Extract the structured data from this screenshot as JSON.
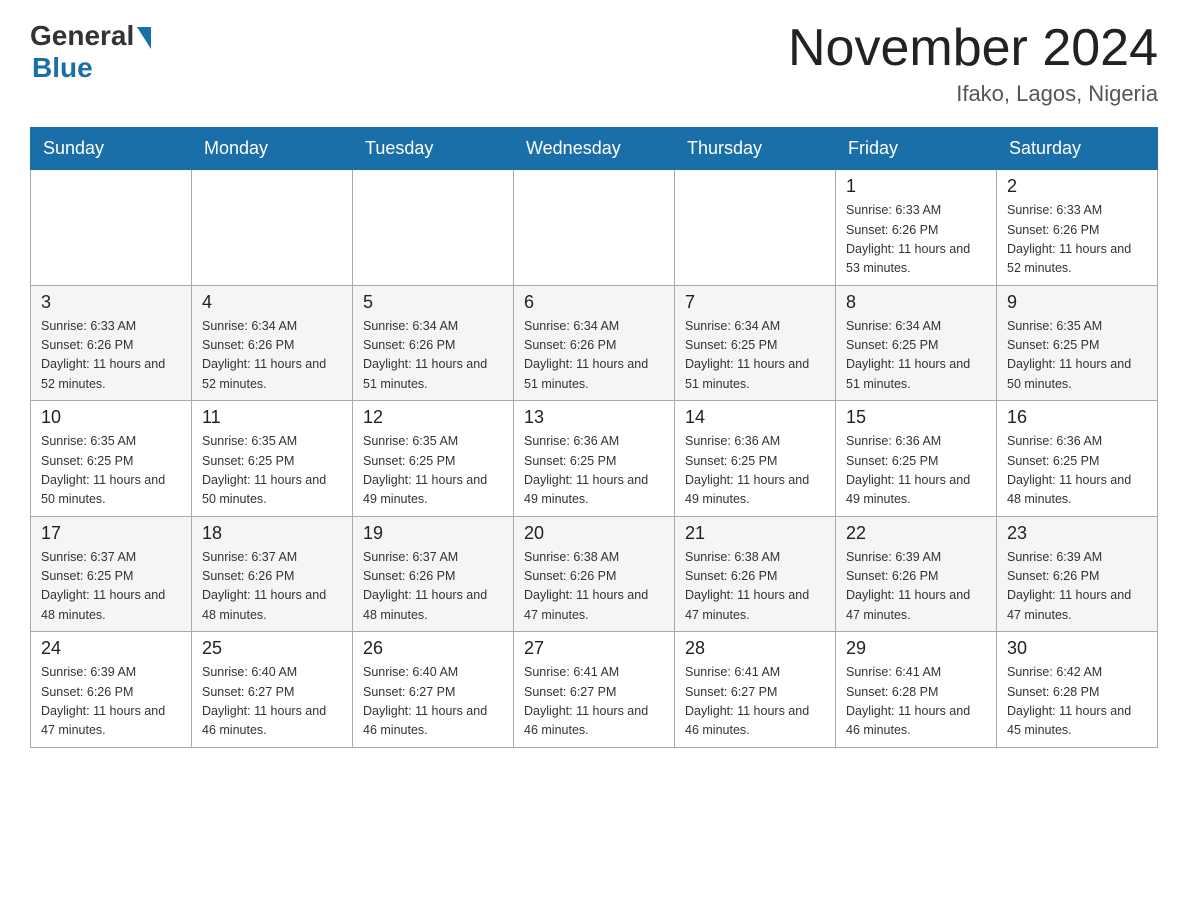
{
  "logo": {
    "general": "General",
    "blue": "Blue",
    "subtitle": "Blue"
  },
  "header": {
    "month_year": "November 2024",
    "location": "Ifako, Lagos, Nigeria"
  },
  "days_of_week": [
    "Sunday",
    "Monday",
    "Tuesday",
    "Wednesday",
    "Thursday",
    "Friday",
    "Saturday"
  ],
  "weeks": [
    [
      {
        "day": "",
        "info": ""
      },
      {
        "day": "",
        "info": ""
      },
      {
        "day": "",
        "info": ""
      },
      {
        "day": "",
        "info": ""
      },
      {
        "day": "",
        "info": ""
      },
      {
        "day": "1",
        "info": "Sunrise: 6:33 AM\nSunset: 6:26 PM\nDaylight: 11 hours and 53 minutes."
      },
      {
        "day": "2",
        "info": "Sunrise: 6:33 AM\nSunset: 6:26 PM\nDaylight: 11 hours and 52 minutes."
      }
    ],
    [
      {
        "day": "3",
        "info": "Sunrise: 6:33 AM\nSunset: 6:26 PM\nDaylight: 11 hours and 52 minutes."
      },
      {
        "day": "4",
        "info": "Sunrise: 6:34 AM\nSunset: 6:26 PM\nDaylight: 11 hours and 52 minutes."
      },
      {
        "day": "5",
        "info": "Sunrise: 6:34 AM\nSunset: 6:26 PM\nDaylight: 11 hours and 51 minutes."
      },
      {
        "day": "6",
        "info": "Sunrise: 6:34 AM\nSunset: 6:26 PM\nDaylight: 11 hours and 51 minutes."
      },
      {
        "day": "7",
        "info": "Sunrise: 6:34 AM\nSunset: 6:25 PM\nDaylight: 11 hours and 51 minutes."
      },
      {
        "day": "8",
        "info": "Sunrise: 6:34 AM\nSunset: 6:25 PM\nDaylight: 11 hours and 51 minutes."
      },
      {
        "day": "9",
        "info": "Sunrise: 6:35 AM\nSunset: 6:25 PM\nDaylight: 11 hours and 50 minutes."
      }
    ],
    [
      {
        "day": "10",
        "info": "Sunrise: 6:35 AM\nSunset: 6:25 PM\nDaylight: 11 hours and 50 minutes."
      },
      {
        "day": "11",
        "info": "Sunrise: 6:35 AM\nSunset: 6:25 PM\nDaylight: 11 hours and 50 minutes."
      },
      {
        "day": "12",
        "info": "Sunrise: 6:35 AM\nSunset: 6:25 PM\nDaylight: 11 hours and 49 minutes."
      },
      {
        "day": "13",
        "info": "Sunrise: 6:36 AM\nSunset: 6:25 PM\nDaylight: 11 hours and 49 minutes."
      },
      {
        "day": "14",
        "info": "Sunrise: 6:36 AM\nSunset: 6:25 PM\nDaylight: 11 hours and 49 minutes."
      },
      {
        "day": "15",
        "info": "Sunrise: 6:36 AM\nSunset: 6:25 PM\nDaylight: 11 hours and 49 minutes."
      },
      {
        "day": "16",
        "info": "Sunrise: 6:36 AM\nSunset: 6:25 PM\nDaylight: 11 hours and 48 minutes."
      }
    ],
    [
      {
        "day": "17",
        "info": "Sunrise: 6:37 AM\nSunset: 6:25 PM\nDaylight: 11 hours and 48 minutes."
      },
      {
        "day": "18",
        "info": "Sunrise: 6:37 AM\nSunset: 6:26 PM\nDaylight: 11 hours and 48 minutes."
      },
      {
        "day": "19",
        "info": "Sunrise: 6:37 AM\nSunset: 6:26 PM\nDaylight: 11 hours and 48 minutes."
      },
      {
        "day": "20",
        "info": "Sunrise: 6:38 AM\nSunset: 6:26 PM\nDaylight: 11 hours and 47 minutes."
      },
      {
        "day": "21",
        "info": "Sunrise: 6:38 AM\nSunset: 6:26 PM\nDaylight: 11 hours and 47 minutes."
      },
      {
        "day": "22",
        "info": "Sunrise: 6:39 AM\nSunset: 6:26 PM\nDaylight: 11 hours and 47 minutes."
      },
      {
        "day": "23",
        "info": "Sunrise: 6:39 AM\nSunset: 6:26 PM\nDaylight: 11 hours and 47 minutes."
      }
    ],
    [
      {
        "day": "24",
        "info": "Sunrise: 6:39 AM\nSunset: 6:26 PM\nDaylight: 11 hours and 47 minutes."
      },
      {
        "day": "25",
        "info": "Sunrise: 6:40 AM\nSunset: 6:27 PM\nDaylight: 11 hours and 46 minutes."
      },
      {
        "day": "26",
        "info": "Sunrise: 6:40 AM\nSunset: 6:27 PM\nDaylight: 11 hours and 46 minutes."
      },
      {
        "day": "27",
        "info": "Sunrise: 6:41 AM\nSunset: 6:27 PM\nDaylight: 11 hours and 46 minutes."
      },
      {
        "day": "28",
        "info": "Sunrise: 6:41 AM\nSunset: 6:27 PM\nDaylight: 11 hours and 46 minutes."
      },
      {
        "day": "29",
        "info": "Sunrise: 6:41 AM\nSunset: 6:28 PM\nDaylight: 11 hours and 46 minutes."
      },
      {
        "day": "30",
        "info": "Sunrise: 6:42 AM\nSunset: 6:28 PM\nDaylight: 11 hours and 45 minutes."
      }
    ]
  ]
}
